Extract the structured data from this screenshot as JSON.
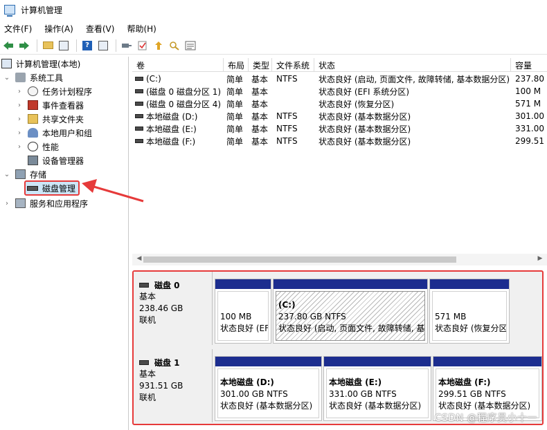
{
  "window": {
    "title": "计算机管理"
  },
  "menu": [
    "文件(F)",
    "操作(A)",
    "查看(V)",
    "帮助(H)"
  ],
  "toolbar": {
    "icons": [
      "back-icon",
      "forward-icon",
      "up-folder-icon",
      "show-hide-tree-icon",
      "help-icon",
      "properties-icon",
      "connect-icon",
      "check-icon",
      "export-icon",
      "search-icon",
      "list-icon"
    ]
  },
  "tree": {
    "root": "计算机管理(本地)",
    "system_tools": "系统工具",
    "task_scheduler": "任务计划程序",
    "event_viewer": "事件查看器",
    "shared_folders": "共享文件夹",
    "local_users": "本地用户和组",
    "performance": "性能",
    "device_manager": "设备管理器",
    "storage": "存储",
    "disk_management": "磁盘管理",
    "services": "服务和应用程序"
  },
  "columns": [
    "卷",
    "布局",
    "类型",
    "文件系统",
    "状态",
    "容量"
  ],
  "volumes": [
    {
      "name": "(C:)",
      "layout": "简单",
      "type": "基本",
      "fs": "NTFS",
      "status": "状态良好 (启动, 页面文件, 故障转储, 基本数据分区)",
      "capacity": "237.80"
    },
    {
      "name": "(磁盘 0 磁盘分区 1)",
      "layout": "简单",
      "type": "基本",
      "fs": "",
      "status": "状态良好 (EFI 系统分区)",
      "capacity": "100 M"
    },
    {
      "name": "(磁盘 0 磁盘分区 4)",
      "layout": "简单",
      "type": "基本",
      "fs": "",
      "status": "状态良好 (恢复分区)",
      "capacity": "571 M"
    },
    {
      "name": "本地磁盘 (D:)",
      "layout": "简单",
      "type": "基本",
      "fs": "NTFS",
      "status": "状态良好 (基本数据分区)",
      "capacity": "301.00"
    },
    {
      "name": "本地磁盘 (E:)",
      "layout": "简单",
      "type": "基本",
      "fs": "NTFS",
      "status": "状态良好 (基本数据分区)",
      "capacity": "331.00"
    },
    {
      "name": "本地磁盘 (F:)",
      "layout": "简单",
      "type": "基本",
      "fs": "NTFS",
      "status": "状态良好 (基本数据分区)",
      "capacity": "299.51"
    }
  ],
  "disks": [
    {
      "name": "磁盘 0",
      "type": "基本",
      "size": "238.46 GB",
      "state": "联机",
      "partitions": [
        {
          "title": "",
          "size": "100 MB",
          "status": "状态良好 (EF"
        },
        {
          "title": "(C:)",
          "size": "237.80 GB NTFS",
          "status": "状态良好 (启动, 页面文件, 故障转储, 基"
        },
        {
          "title": "",
          "size": "571 MB",
          "status": "状态良好 (恢复分区"
        }
      ]
    },
    {
      "name": "磁盘 1",
      "type": "基本",
      "size": "931.51 GB",
      "state": "联机",
      "partitions": [
        {
          "title": "本地磁盘 (D:)",
          "size": "301.00 GB NTFS",
          "status": "状态良好 (基本数据分区)"
        },
        {
          "title": "本地磁盘 (E:)",
          "size": "331.00 GB NTFS",
          "status": "状态良好 (基本数据分区)"
        },
        {
          "title": "本地磁盘 (F:)",
          "size": "299.51 GB NTFS",
          "status": "状态良好 (基本数据分区)"
        }
      ]
    }
  ],
  "watermark": "CSDN @程序员小十一",
  "colors": {
    "partition_bar": "#1c2d8f",
    "highlight": "#e63a3a",
    "selection": "#cde6f7"
  }
}
